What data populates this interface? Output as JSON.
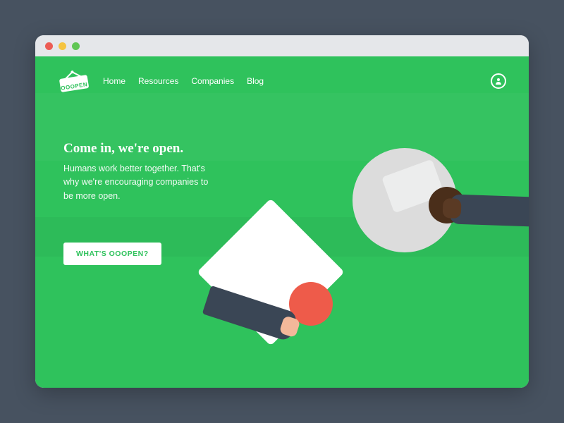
{
  "logo": {
    "text": "OOOPEN"
  },
  "nav": {
    "items": [
      "Home",
      "Resources",
      "Companies",
      "Blog"
    ]
  },
  "hero": {
    "heading": "Come in, we're open.",
    "body": "Humans work better together. That's why we're encouraging companies to be more open."
  },
  "cta": {
    "label": "WHAT'S OOOPEN?"
  },
  "colors": {
    "page": "#2fc25c",
    "accent_red": "#ee5b4a"
  }
}
